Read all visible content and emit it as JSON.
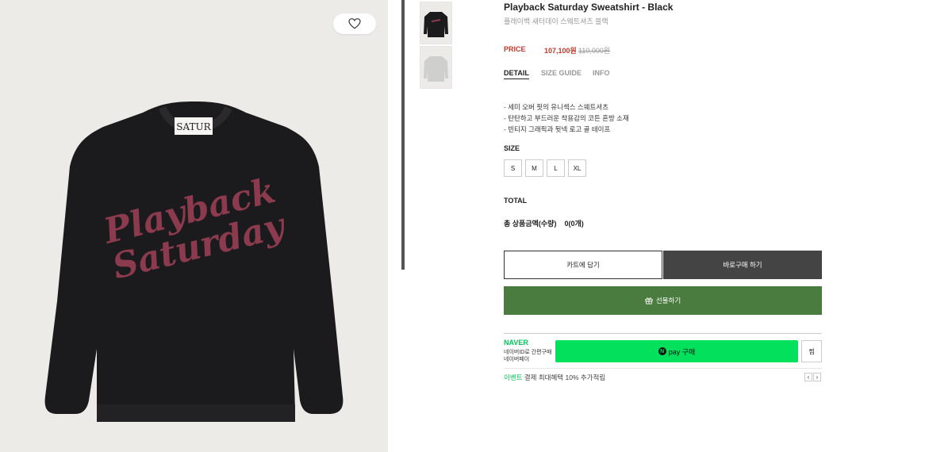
{
  "product": {
    "title": "Playback Saturday Sweatshirt - Black",
    "subtitle": "플레이백 새터데이 스웨트셔츠 블랙",
    "price_label": "PRICE",
    "sale_price": "107,100원",
    "original_price": "110,000원",
    "neck_label": "SATUR",
    "print_line1": "Playback",
    "print_line2": "Saturday"
  },
  "tabs": [
    {
      "label": "DETAIL"
    },
    {
      "label": "SIZE GUIDE"
    },
    {
      "label": "INFO"
    }
  ],
  "description": [
    "- 세미 오버 핏의 유니섹스 스웨트셔츠",
    "- 탄탄하고 부드러운 착용감의 코튼 혼방 소재",
    "- 빈티지 그래픽과 뒷넥 로고 골 테이프"
  ],
  "size": {
    "label": "SIZE",
    "options": [
      "S",
      "M",
      "L",
      "XL"
    ]
  },
  "total": {
    "label": "TOTAL",
    "amount_label": "총 상품금액(수량)",
    "count": "0(0개)"
  },
  "buttons": {
    "cart": "카트에 담기",
    "buy": "바로구매 하기",
    "gift": "선물하기"
  },
  "naver": {
    "logo": "NAVER",
    "sub1": "네이버ID로 간편구매",
    "sub2": "네이버페이",
    "pay_n": "N",
    "pay_label": "pay 구매",
    "wish": "찜",
    "event_tag": "이벤트",
    "event_text": "결제 최대혜택 10% 추가적립",
    "prev": "‹",
    "next": "›"
  },
  "icons": {
    "favorite": "heart-icon",
    "gift": "gift-icon"
  },
  "colors": {
    "sale": "#c0392b",
    "gift_button": "#4a7c3f",
    "buy_button": "#444444",
    "naver_green": "#03c75a",
    "npay_button": "#03e05b"
  }
}
